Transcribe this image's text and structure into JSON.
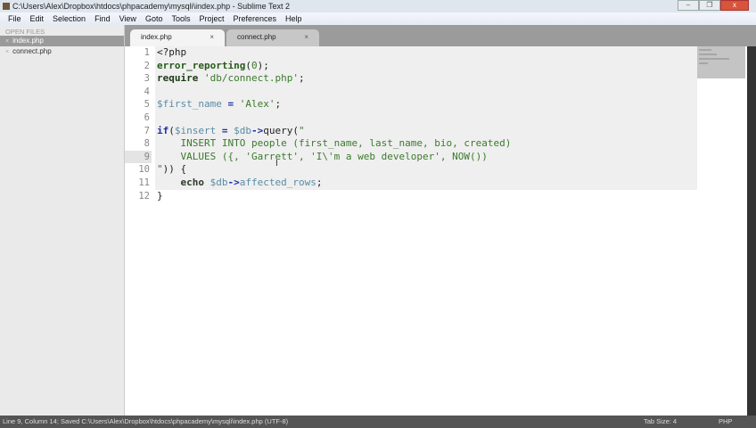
{
  "window": {
    "title": "C:\\Users\\Alex\\Dropbox\\htdocs\\phpacademy\\mysqli\\index.php - Sublime Text 2",
    "min": "–",
    "max": "❐",
    "close": "x"
  },
  "menu": [
    "File",
    "Edit",
    "Selection",
    "Find",
    "View",
    "Goto",
    "Tools",
    "Project",
    "Preferences",
    "Help"
  ],
  "sidebar": {
    "heading": "OPEN FILES",
    "files": [
      {
        "close": "×",
        "name": "index.php"
      },
      {
        "close": "×",
        "name": "connect.php"
      }
    ]
  },
  "tabs": [
    {
      "label": "index.php",
      "close": "×"
    },
    {
      "label": "connect.php",
      "close": "×"
    }
  ],
  "code": [
    [
      [
        "pl",
        "<?php"
      ]
    ],
    [
      [
        "fn",
        "error_reporting"
      ],
      [
        "pl",
        "("
      ],
      [
        "st",
        "0"
      ],
      [
        "pl",
        ");"
      ]
    ],
    [
      [
        "rq",
        "require"
      ],
      [
        "pl",
        " "
      ],
      [
        "st",
        "'db/connect.php'"
      ],
      [
        "pl",
        ";"
      ]
    ],
    [],
    [
      [
        "var",
        "$first_name"
      ],
      [
        "pl",
        " "
      ],
      [
        "op",
        "="
      ],
      [
        "pl",
        " "
      ],
      [
        "st",
        "'Alex'"
      ],
      [
        "pl",
        ";"
      ]
    ],
    [],
    [
      [
        "kw",
        "if"
      ],
      [
        "pl",
        "("
      ],
      [
        "var",
        "$insert"
      ],
      [
        "pl",
        " "
      ],
      [
        "op",
        "="
      ],
      [
        "pl",
        " "
      ],
      [
        "var",
        "$db"
      ],
      [
        "op",
        "->"
      ],
      [
        "pl",
        "query("
      ],
      [
        "st",
        "\""
      ]
    ],
    [
      [
        "st",
        "    INSERT INTO people (first_name, last_name, bio, created)"
      ]
    ],
    [
      [
        "st",
        "    VALUES ({, 'Garrett', 'I\\'m a web developer', NOW())"
      ]
    ],
    [
      [
        "st",
        "\""
      ],
      [
        "pl",
        ")) {"
      ]
    ],
    [
      [
        "pl",
        "    "
      ],
      [
        "ec",
        "echo"
      ],
      [
        "pl",
        " "
      ],
      [
        "var",
        "$db"
      ],
      [
        "op",
        "->"
      ],
      [
        "var",
        "affected_rows"
      ],
      [
        "pl",
        ";"
      ]
    ],
    [
      [
        "pl",
        "}"
      ]
    ]
  ],
  "status": {
    "left": "Line 9, Column 14; Saved C:\\Users\\Alex\\Dropbox\\htdocs\\phpacademy\\mysqli\\index.php (UTF-8)",
    "tab_size": "Tab Size: 4",
    "syntax": "PHP"
  },
  "cursor_glyph": "I"
}
